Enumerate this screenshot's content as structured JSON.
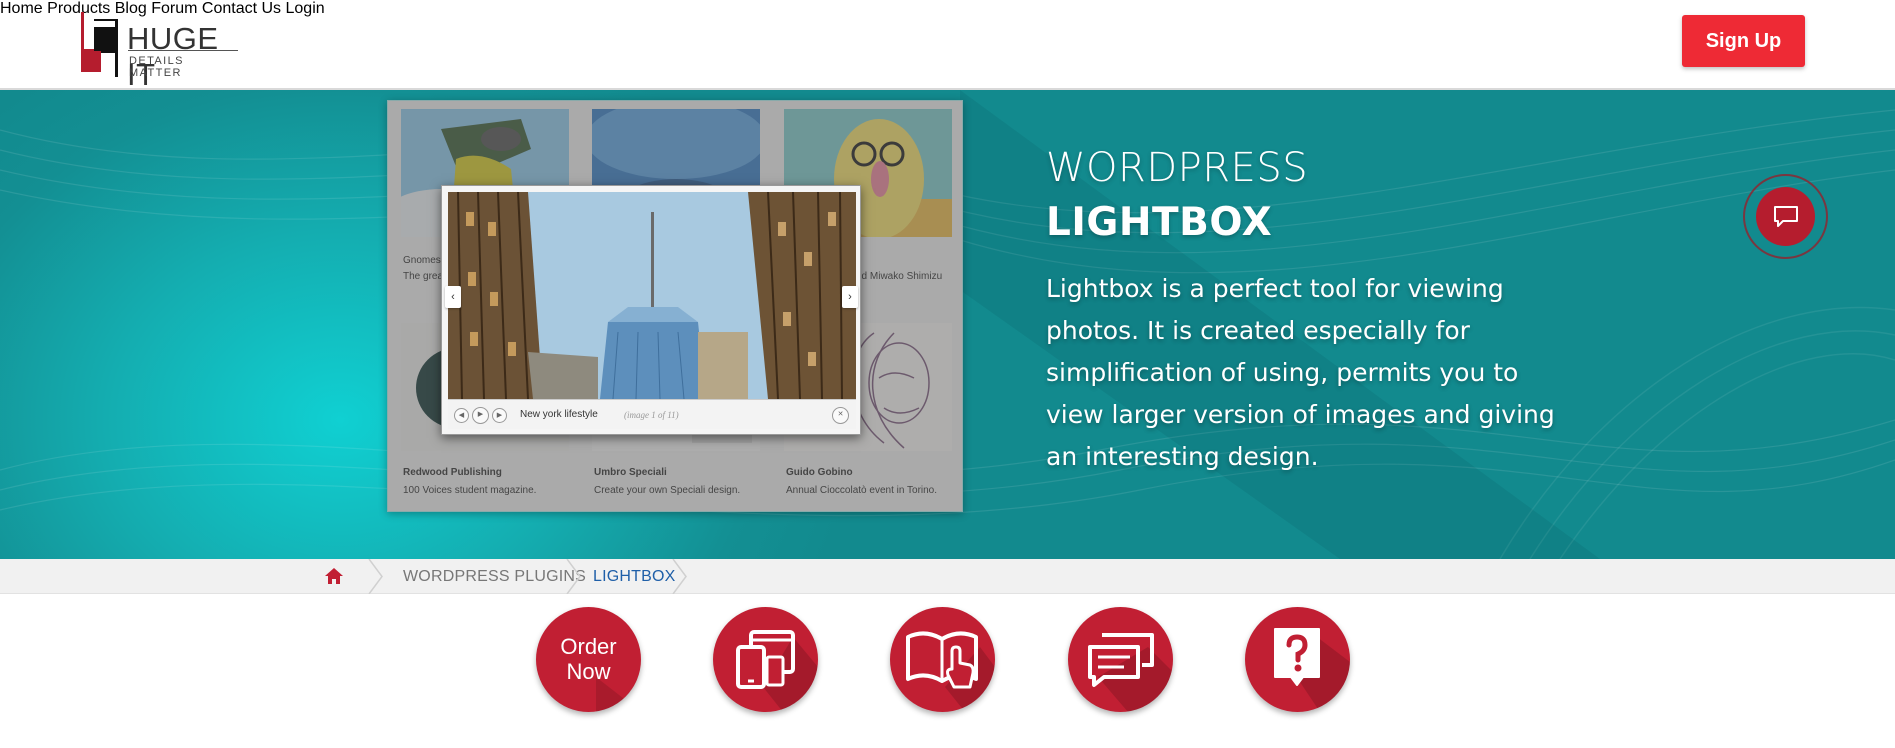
{
  "header": {
    "logo": {
      "title": "HUGE IT",
      "tagline": "DETAILS MATTER"
    },
    "nav": [
      {
        "label": "Home"
      },
      {
        "label": "Products"
      },
      {
        "label": "Blog"
      },
      {
        "label": "Forum"
      },
      {
        "label": "Contact Us"
      },
      {
        "label": "Login"
      }
    ],
    "signup_label": "Sign Up"
  },
  "hero": {
    "title_line1": "WORDPRESS",
    "title_line2": "LIGHTBOX",
    "description": "Lightbox is a perfect tool for viewing photos. It is created especially for simplification of using, permits you to view larger version of images and giving an interesting design.",
    "preview": {
      "gallery_items": [
        {
          "title": "Gnomes",
          "text": "The grea"
        },
        {
          "title": "",
          "text": ""
        },
        {
          "title": "",
          "text": "nd Miwako Shimizu"
        },
        {
          "title": "Redwood Publishing",
          "text": "100 Voices student magazine."
        },
        {
          "title": "Umbro Speciali",
          "text": "Create your own Speciali design."
        },
        {
          "title": "Guido Gobino",
          "text": "Annual Cioccolatò event in Torino."
        }
      ],
      "lightbox_title": "New york lifestyle",
      "lightbox_counter": "(image 1 of 11)"
    },
    "chat_icon": "chat-bubble-icon"
  },
  "breadcrumb": {
    "home_icon": "home-icon",
    "items": [
      "WORDPRESS PLUGINS",
      "LIGHTBOX"
    ]
  },
  "actions": {
    "order_label_line1": "Order",
    "order_label_line2": "Now",
    "icons": [
      "devices-icon",
      "book-touch-icon",
      "chat-forum-icon",
      "help-question-icon"
    ]
  },
  "colors": {
    "brand_red": "#c11f33",
    "signup_red": "#ee2a35",
    "hero_teal": "#14adb0",
    "breadcrumb_active": "#1f5fa8"
  }
}
